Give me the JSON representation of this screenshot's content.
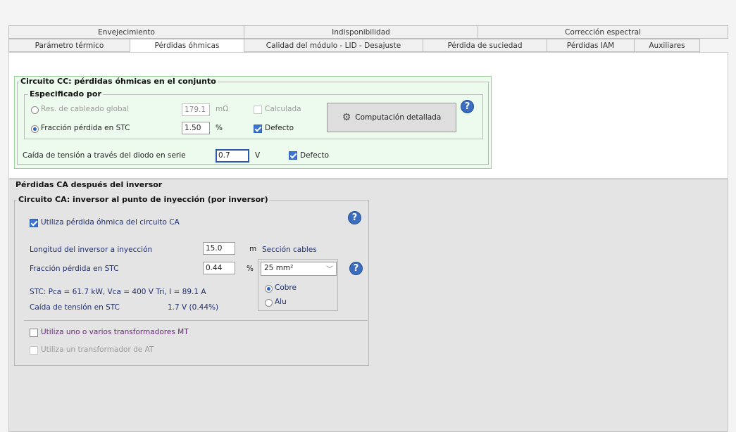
{
  "tabs_top": [
    "Envejecimiento",
    "Indisponibilidad",
    "Corrección espectral"
  ],
  "tabs_bottom": [
    "Parámetro térmico",
    "Pérdidas óhmicas",
    "Calidad del módulo - LID - Desajuste",
    "Pérdida de suciedad",
    "Pérdidas IAM",
    "Auxiliares"
  ],
  "active_tab": "Pérdidas óhmicas",
  "dc_circuit": {
    "title": "Circuito CC: pérdidas óhmicas en el conjunto",
    "specified_by_title": "Especificado por",
    "option_global_resistance": "Res. de cableado global",
    "global_resistance_value": "179.1",
    "global_resistance_unit": "mΩ",
    "calculated_label": "Calculada",
    "option_stc_fraction": "Fracción pérdida en STC",
    "stc_fraction_value": "1.50",
    "stc_fraction_unit": "%",
    "default_label": "Defecto",
    "detailed_button_label": "Computación detallada",
    "diode_drop_label": "Caída de tensión a través del diodo en serie",
    "diode_drop_value": "0.7",
    "diode_drop_unit": "V",
    "diode_default_label": "Defecto"
  },
  "ac_losses": {
    "title": "Pérdidas CA después del inversor",
    "circuit_title": "Circuito CA: inversor al punto de inyección  (por inversor)",
    "use_ac_loss_label": "Utiliza pérdida óhmica del circuito CA",
    "length_label": "Longitud del inversor a inyección",
    "length_value": "15.0",
    "length_unit": "m",
    "cable_section_label": "Sección cables",
    "stc_fraction_label": "Fracción pérdida en STC",
    "stc_fraction_value": "0.44",
    "stc_fraction_unit": "%",
    "cable_section_value": "25 mm²",
    "material_copper": "Cobre",
    "material_alu": "Alu",
    "stc_summary": "STC: Pca = 61.7 kW,  Vca = 400 V Tri,  I = 89.1 A",
    "voltage_drop_label": "Caída de tensión en STC",
    "voltage_drop_value": "1.7 V  (0.44%)",
    "mv_transformer_label": "Utiliza uno o varios transformadores MT",
    "hv_transformer_label": "Utiliza un transformador de AT"
  },
  "colors": {
    "accent_blue": "#3b74d6",
    "green_panel": "#edfaee",
    "gray_panel": "#e4e4e4",
    "purple_text": "#6a2a7a"
  }
}
